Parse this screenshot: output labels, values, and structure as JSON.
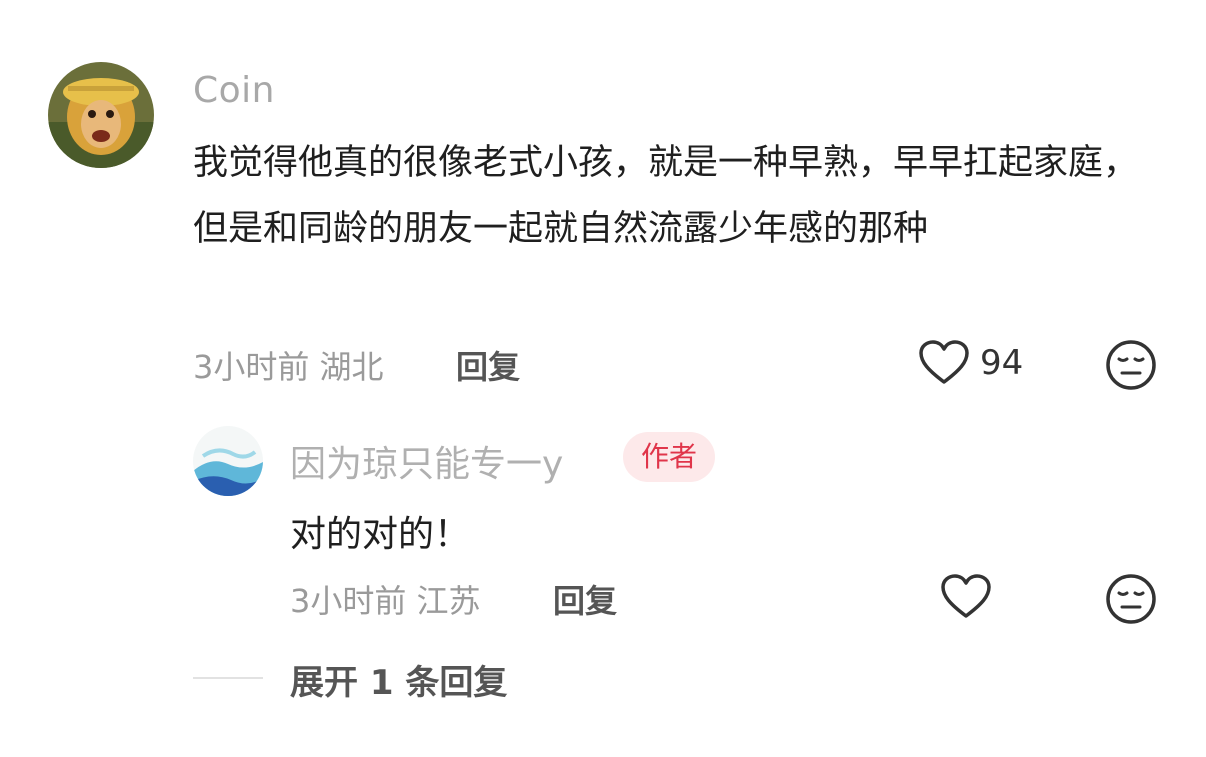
{
  "comment": {
    "username": "Coin",
    "text": "我觉得他真的很像老式小孩，就是一种早熟，早早扛起家庭，但是和同龄的朋友一起就自然流露少年感的那种",
    "time_location": "3小时前 湖北",
    "reply_label": "回复",
    "like_count": "94",
    "avatar_icon": "monkey-king-avatar"
  },
  "reply": {
    "username": "因为琼只能专一y",
    "badge": "作者",
    "text": "对的对的！",
    "time_location": "3小时前 江苏",
    "reply_label": "回复",
    "avatar_icon": "watercolor-avatar"
  },
  "expand": {
    "label": "展开 1 条回复"
  },
  "colors": {
    "badge_bg": "#fde9ea",
    "badge_text": "#e0354a",
    "meta": "#9a9a9a"
  }
}
